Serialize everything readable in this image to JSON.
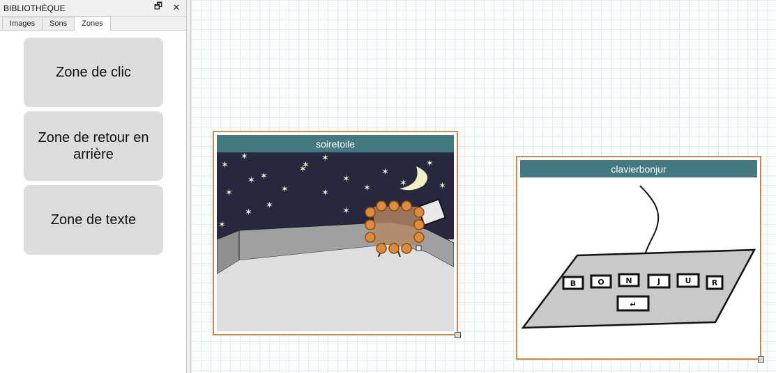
{
  "panel": {
    "title": "BIBLIOTHÈQUE",
    "restore_glyph": "🗗",
    "close_glyph": "✕",
    "tabs": [
      {
        "label": "Images",
        "active": false
      },
      {
        "label": "Sons",
        "active": false
      },
      {
        "label": "Zones",
        "active": true
      }
    ],
    "zones": [
      {
        "label": "Zone de clic"
      },
      {
        "label": "Zone de retour en arrière"
      },
      {
        "label": "Zone de texte"
      }
    ]
  },
  "canvas": {
    "nodes": [
      {
        "title": "soiretoile"
      },
      {
        "title": "clavierbonjur"
      }
    ],
    "keyboard_keys": [
      "B",
      "O",
      "N",
      "J",
      "U",
      "R",
      "↵"
    ]
  },
  "colors": {
    "node_border": "#c98a4a",
    "node_header": "#437980",
    "zone_button": "#dcdcdc",
    "night_sky": "#272840"
  }
}
